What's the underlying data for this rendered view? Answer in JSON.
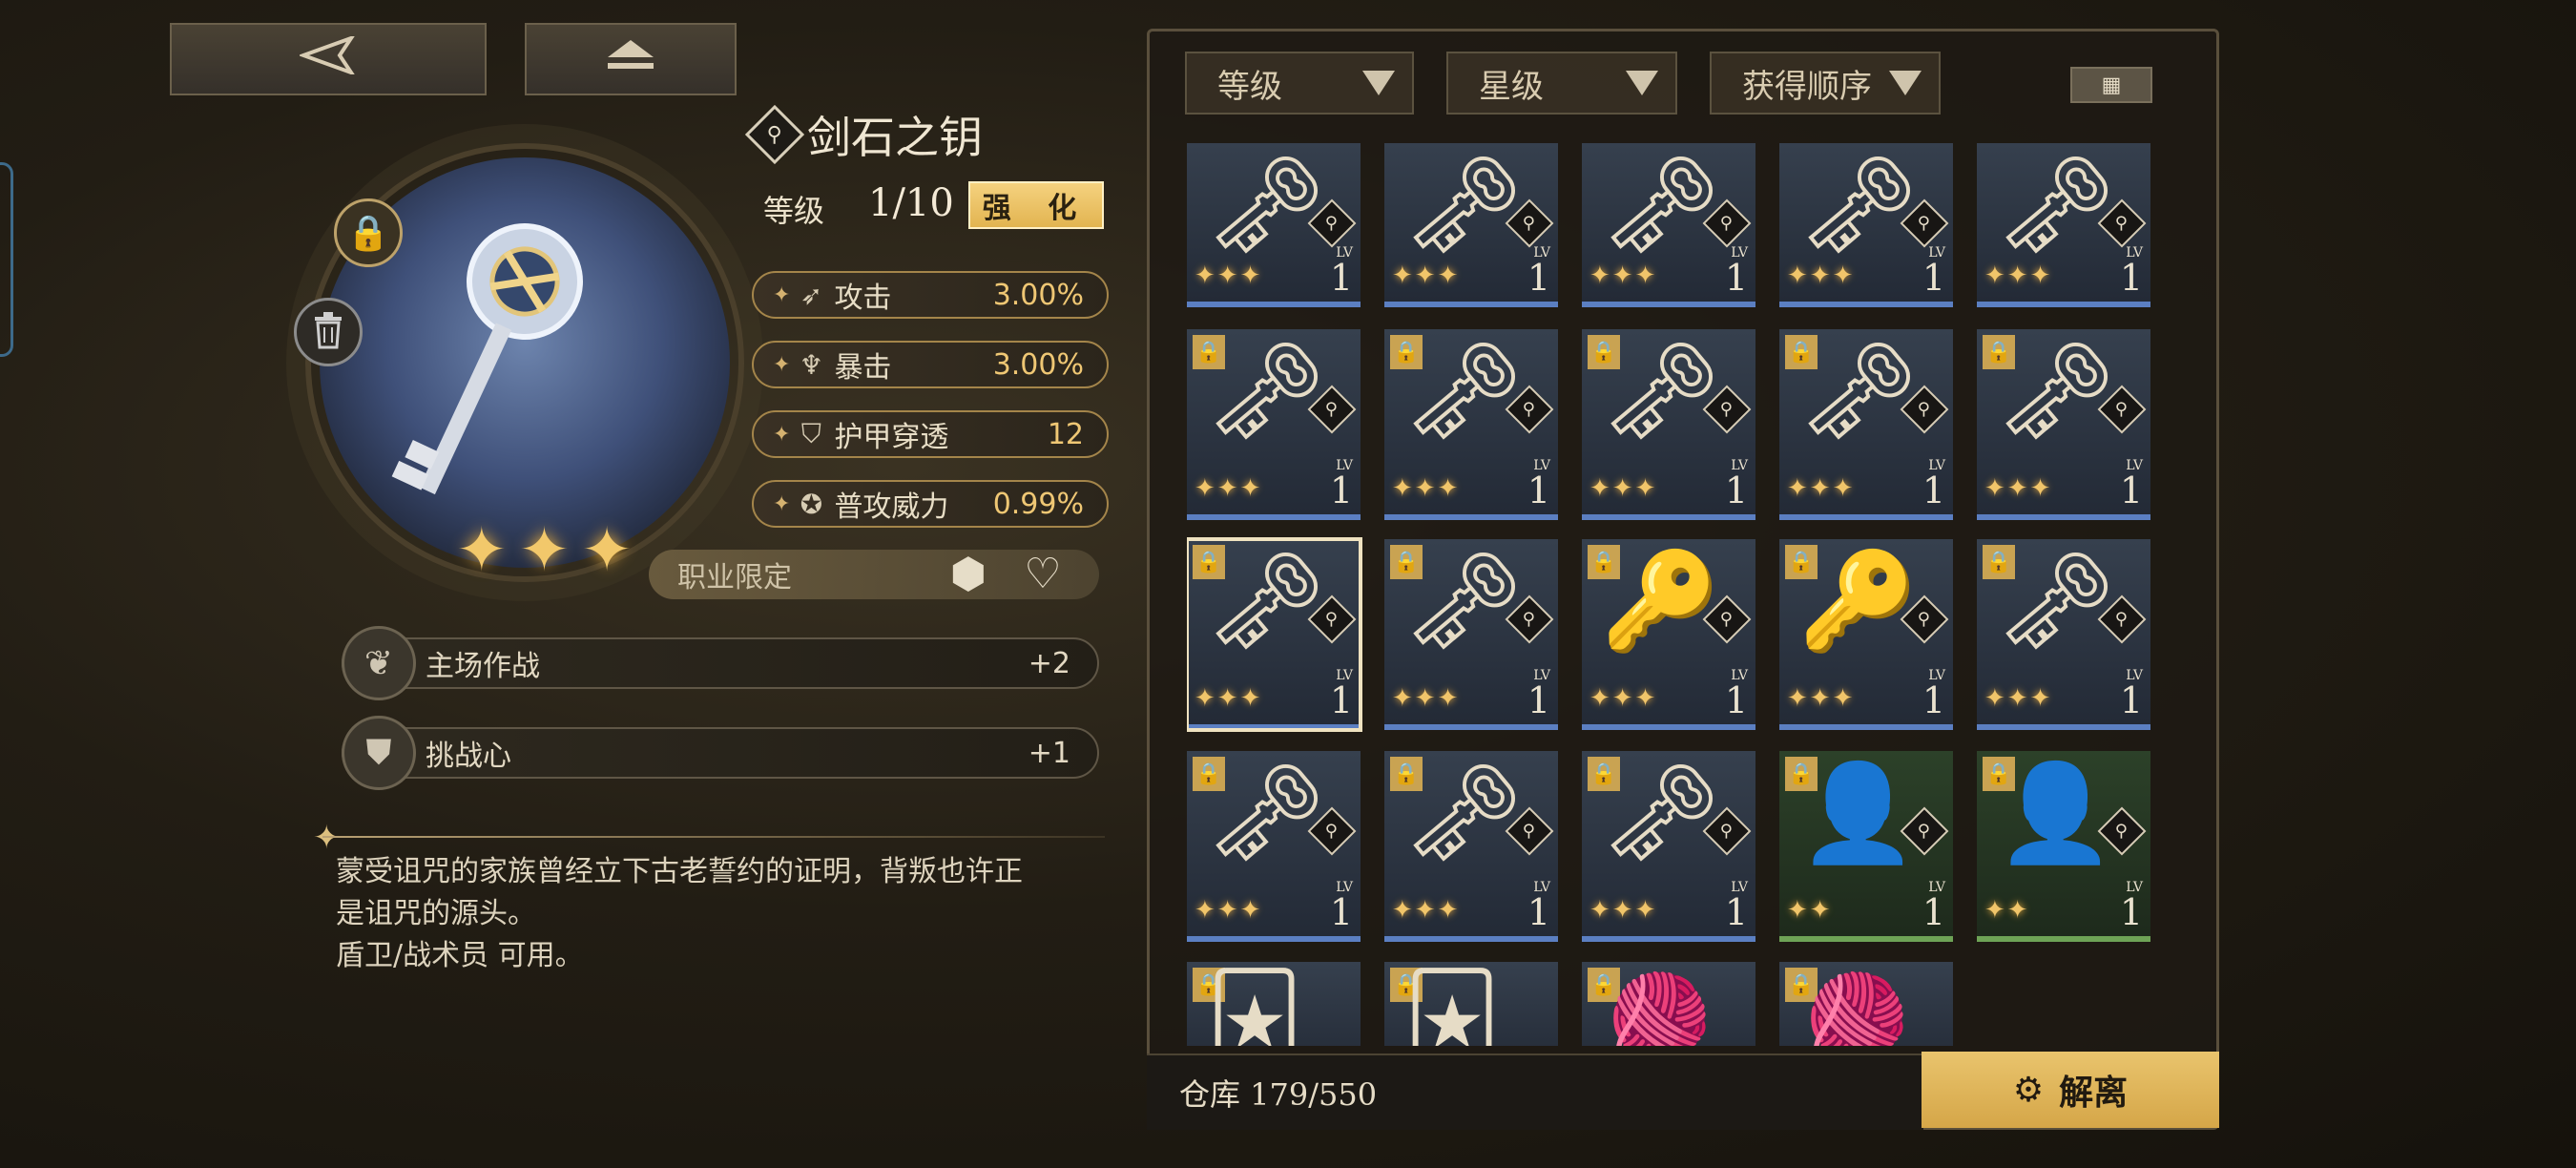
{
  "nav": {
    "back_icon": "back-arrow-icon",
    "eject_icon": "eject-icon"
  },
  "item": {
    "name": "剑石之钥",
    "level_label": "等级",
    "level": "1/10",
    "enhance_label": "强 化",
    "stars": 3,
    "stats": [
      {
        "label": "攻击",
        "value": "3.00%",
        "icon": "sword-icon"
      },
      {
        "label": "暴击",
        "value": "3.00%",
        "icon": "crit-icon"
      },
      {
        "label": "护甲穿透",
        "value": "12",
        "icon": "armor-pierce-icon"
      },
      {
        "label": "普攻威力",
        "value": "0.99%",
        "icon": "attack-power-icon"
      }
    ],
    "class_limit_label": "职业限定",
    "skills": [
      {
        "label": "主场作战",
        "value": "+2",
        "icon": "wings-icon"
      },
      {
        "label": "挑战心",
        "value": "+1",
        "icon": "shield-icon"
      }
    ],
    "description_lines": [
      "蒙受诅咒的家族曾经立下古老誓约的证明，背叛也许正",
      "是诅咒的源头。",
      "盾卫/战术员 可用。"
    ]
  },
  "inventory": {
    "filters": [
      "等级",
      "星级",
      "获得顺序"
    ],
    "storage_label": "仓库 179/550",
    "dismantle_label": "解离",
    "slot_lv_label": "LV",
    "slot_level": "1",
    "colors": {
      "accent_gold": "#e2b451",
      "rarity_blue": "#5b7fc2",
      "rarity_green": "#6ea356"
    }
  }
}
